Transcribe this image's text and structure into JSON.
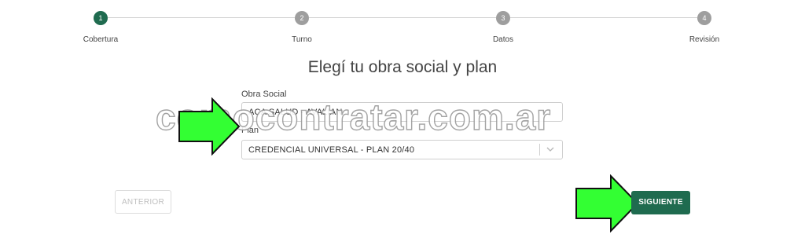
{
  "stepper": {
    "steps": [
      {
        "number": "1",
        "label": "Cobertura",
        "active": true
      },
      {
        "number": "2",
        "label": "Turno",
        "active": false
      },
      {
        "number": "3",
        "label": "Datos",
        "active": false
      },
      {
        "number": "4",
        "label": "Revisión",
        "active": false
      }
    ]
  },
  "page": {
    "title": "Elegí tu obra social y plan"
  },
  "form": {
    "obra_social": {
      "label": "Obra Social",
      "value": "ACA SALUD - AVALIAN"
    },
    "plan": {
      "label": "Plan",
      "value": "CREDENCIAL UNIVERSAL - PLAN 20/40"
    }
  },
  "buttons": {
    "prev_label": "ANTERIOR",
    "next_label": "SIGUIENTE"
  },
  "watermark": {
    "text": "comocontratar.com.ar"
  },
  "colors": {
    "accent": "#1f6b4f",
    "arrow": "#33ff33",
    "step_inactive": "#9e9e9e"
  },
  "icons": {
    "select_chevron": "chevron-down-icon",
    "pointer": "arrow-right-icon"
  }
}
